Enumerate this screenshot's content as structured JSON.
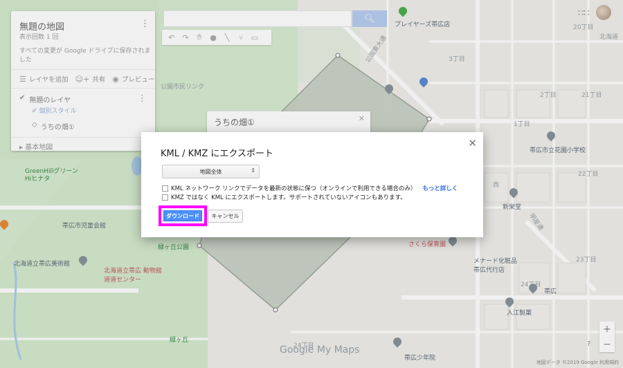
{
  "panel": {
    "title": "無題の地図",
    "views": "表示回数 1 回",
    "saved_status": "すべての変更が Google ドライブに保存されました",
    "actions": {
      "add_layer": "レイヤを追加",
      "share": "共有",
      "preview": "プレビュー"
    },
    "layer_name": "無題のレイヤ",
    "layer_style": "個別スタイル",
    "layer_item": "うちの畑①",
    "base_map": "基本地図"
  },
  "info_card": {
    "title": "うちの畑①"
  },
  "map_labels": {
    "player": "プレイヤーズ帯広店",
    "street_20": "20丁目",
    "hokkaido": "北海道",
    "kouen": "公園東大通",
    "shiminlink": "公園市民リンク",
    "c3": "3丁目",
    "c2": "2丁目",
    "c21": "21丁目",
    "c1": "1丁目",
    "school": "帯広市立花園小学校",
    "c22": "22丁目",
    "greenhill": "GreenHillグリーン",
    "hinata": "Hiヒナタ",
    "nishi": "西",
    "shinpudo": "新栄堂",
    "kaikan": "帯広市児童会館",
    "midori": "緑ヶ丘公園",
    "museum": "北海道立帯広美術館",
    "center": "北海道立帯広 動物館道道センター",
    "sakura": "さくら保育園",
    "medical": "メナード化粧品 帯広代行店",
    "c23": "23丁目",
    "c24": "24丁目",
    "obihiro": "帯広",
    "ireko": "入江製菓",
    "shonen": "帯広少年院",
    "midorigaoka": "緑ヶ丘",
    "nishi24": "24丁目",
    "meisei": "明星通"
  },
  "brand": {
    "google": "Google",
    "mymaps": "My Maps"
  },
  "attribution": "地図データ ©2019 Google    利用規約",
  "zoom": {
    "in": "+",
    "out": "−"
  },
  "help": "?",
  "dialog": {
    "title": "KML / KMZ にエクスポート",
    "select_value": "地図全体",
    "option1": "KML ネットワーク リンクでデータを最新の状態に保つ（オンラインで利用できる場合のみ）",
    "option1_link": "もっと詳しく",
    "option2": "KMZ ではなく KML にエクスポートします。サポートされていないアイコンもあります。",
    "download": "ダウンロード",
    "cancel": "キャンセル"
  },
  "colors": {
    "primary_button": "#4d90fe",
    "highlight": "#ff00ff",
    "polygon_fill": "#c9d1c5",
    "park": "#cbe6c4"
  }
}
